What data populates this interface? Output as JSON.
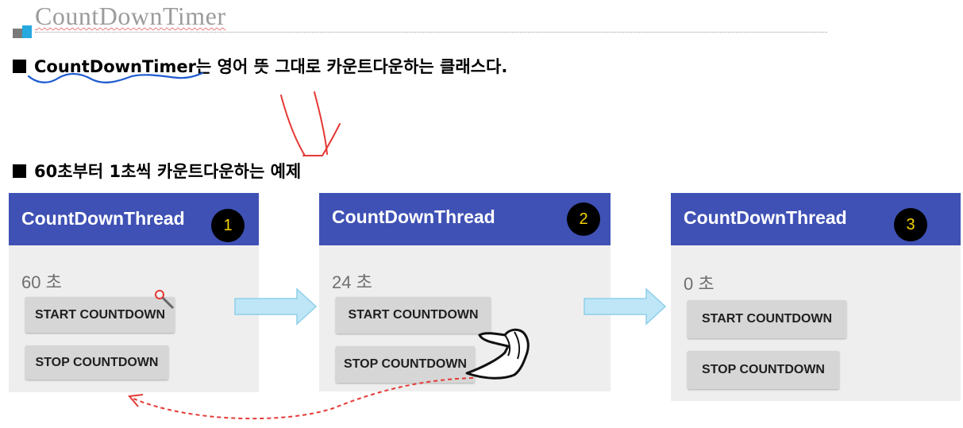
{
  "title": "CountDownTimer",
  "heading1": {
    "term": "CountDownTimer",
    "rest": "는 영어 뜻 그대로 카운트다운하는 클래스다."
  },
  "heading2": "60초부터 1초씩 카운트다운하는 예제",
  "panels": [
    {
      "app_title": "CountDownThread",
      "step": "1",
      "count": "60 초",
      "start_label": "START COUNTDOWN",
      "stop_label": "STOP COUNTDOWN"
    },
    {
      "app_title": "CountDownThread",
      "step": "2",
      "count": "24 초",
      "start_label": "START COUNTDOWN",
      "stop_label": "STOP COUNTDOWN"
    },
    {
      "app_title": "CountDownThread",
      "step": "3",
      "count": "0 초",
      "start_label": "START COUNTDOWN",
      "stop_label": "STOP COUNTDOWN"
    }
  ],
  "colors": {
    "appbar": "#3f51b5",
    "badge_text": "#f5d400",
    "annotation_red": "#e53935",
    "annotation_blue": "#1e5bd1",
    "arrow_fill": "#bfe6f7"
  },
  "icons": [
    "flow-arrow-icon",
    "hand-pointer-icon",
    "pin-cursor-icon"
  ]
}
